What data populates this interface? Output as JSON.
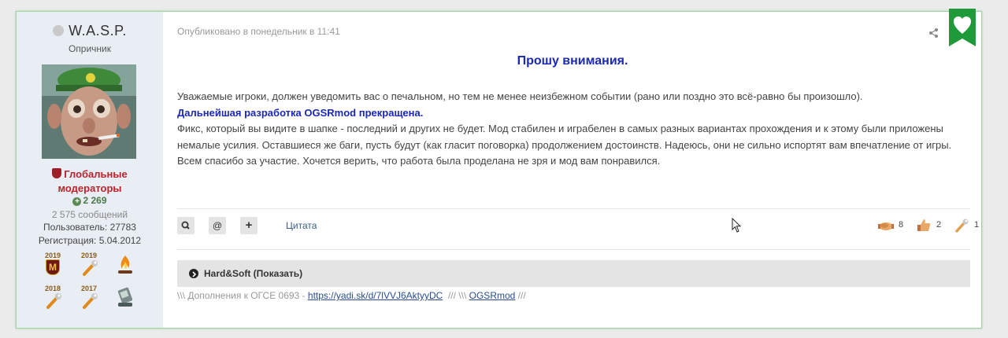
{
  "author": {
    "name": "W.A.S.P.",
    "title": "Опричник",
    "group_line1": "Глобальные",
    "group_line2": "модераторы",
    "reputation": "2 269",
    "posts_count": "2 575 сообщений",
    "user_id": "Пользователь: 27783",
    "registered": "Регистрация: 5.04.2012",
    "awards": [
      {
        "year": "2019",
        "icon": "moderator-badge-icon"
      },
      {
        "year": "2019",
        "icon": "wrench-icon"
      },
      {
        "year": "",
        "icon": "campfire-icon"
      },
      {
        "year": "2018",
        "icon": "wrench-icon"
      },
      {
        "year": "2017",
        "icon": "wrench-icon"
      },
      {
        "year": "",
        "icon": "pda-icon"
      }
    ]
  },
  "post": {
    "published": "Опубликовано в понедельник в 11:41",
    "headline": "Прошу внимания.",
    "para1": "Уважаемые игроки, должен уведомить вас о печальном, но тем не менее неизбежном событии (рано или поздно это всё-равно бы произошло).",
    "para2": "Дальнейшая разработка OGSRmod прекращена.",
    "para3": "Фикс, который вы видите в шапке - последний и других не будет. Мод стабилен и играбелен в самых разных вариантах прохождения и к этому были приложены немалые усилия. Оставшиеся же баги, пусть будут (как гласит поговорка) продолжением достоинств. Надеюсь, они не сильно испортят вам впечатление от игры. Всем спасибо за участие. Хочется верить, что работа была проделана не зря и мод вам понравился."
  },
  "toolbar": {
    "search_glyph": "🔍",
    "mention_glyph": "@",
    "add_glyph": "+",
    "quote_label": "Цитата"
  },
  "reactions": [
    {
      "icon": "handshake-icon",
      "count": "8"
    },
    {
      "icon": "thumbs-up-icon",
      "count": "2"
    },
    {
      "icon": "wrench-icon",
      "count": "1"
    }
  ],
  "spoiler": {
    "label": "Hard&Soft (Показать)"
  },
  "signature": {
    "prefix": "\\\\\\ Дополнения к ОГСЕ 0693 - ",
    "link1": "https://yadi.sk/d/7lVVJ6AktyyDC",
    "middle": "  /// \\\\\\ ",
    "link2": "OGSRmod",
    "suffix": " ///"
  },
  "colors": {
    "accent": "#1a28b5",
    "group": "#b8242d",
    "favorite": "#1e9a3a",
    "border": "#9fd69b"
  }
}
